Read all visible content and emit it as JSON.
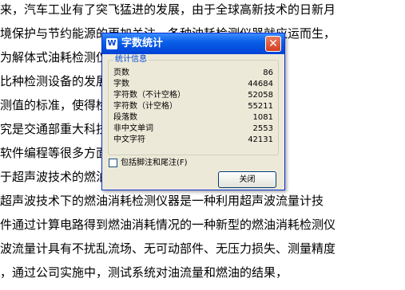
{
  "document": {
    "lines": [
      "来，汽车工业有了突飞猛进的发展，由于全球高新技术的日新月",
      "境保护与节约能源的更加关注，各种油耗检测仪器就应运而生，",
      "为解体式油耗检测仪器，主要为容积法",
      "比种检测设备的发展，我国制定的第一个关于乘用",
      "测值的标准，使得检测更加确切，不解体油耗分",
      "究是交通部重大科技项目，方案确定、硬件设",
      "软件编程等很多方面需要研究一套不解体燃油消",
      "于超声波技术的燃油消耗检测仪器。",
      "超声波技术下的燃油消耗检测仪器是一种利用超声波流量计技",
      "件通过计算电路得到燃油消耗情况的一种新型的燃油消耗检测仪",
      "波流量计具有不扰乱流场、无可动部件、无压力损失、测量精度",
      "，通过公司实施中，测试系统对油流量和燃油的结果，"
    ]
  },
  "dialog": {
    "title": "字数统计",
    "title_icon": "W",
    "close_glyph": "✕",
    "group_label": "统计信息",
    "stats": [
      {
        "label": "页数",
        "value": "86"
      },
      {
        "label": "字数",
        "value": "44684"
      },
      {
        "label": "字符数（不计空格）",
        "value": "52058"
      },
      {
        "label": "字符数（计空格）",
        "value": "55211"
      },
      {
        "label": "段落数",
        "value": "1081"
      },
      {
        "label": "非中文单词",
        "value": "2553"
      },
      {
        "label": "中文字符",
        "value": "42131"
      }
    ],
    "checkbox_label": "包括脚注和尾注(F)",
    "checkbox_checked": false,
    "close_button_label": "关闭"
  },
  "colors": {
    "titlebar": "#0a5fe8",
    "dialog_bg": "#ece9d8",
    "group_label": "#0046d5",
    "close_red": "#d4401f"
  }
}
